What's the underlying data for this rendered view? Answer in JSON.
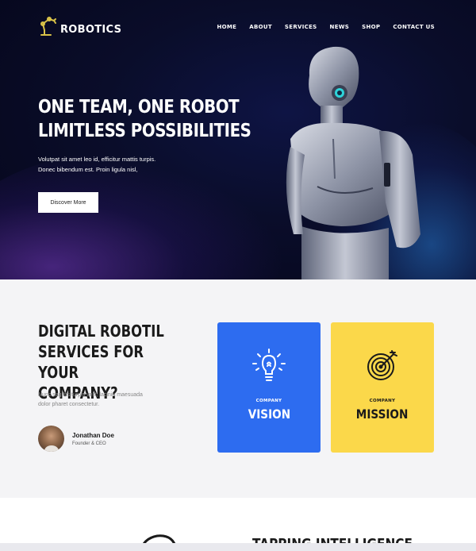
{
  "brand": {
    "name": "ROBOTICS",
    "icon": "robot-arm-icon",
    "accent": "#d9c248"
  },
  "nav": [
    "HOME",
    "ABOUT",
    "SERVICES",
    "NEWS",
    "SHOP",
    "CONTACT US"
  ],
  "hero": {
    "title_line1": "ONE TEAM, ONE ROBOT",
    "title_line2": "LIMITLESS POSSIBILITIES",
    "subtitle_line1": "Volutpat sit amet leo id, efficitur mattis turpis.",
    "subtitle_line2": "Donec bibendum est. Proin ligula nisl,",
    "cta": "Discover More"
  },
  "services": {
    "title_line1": "DIGITAL ROBOTIL",
    "title_line2": "SERVICES FOR YOUR",
    "title_line3": "COMPANY?",
    "desc_line1": "Nunc sagittis turpis velit, lacinia maesuada",
    "desc_line2": "dolor pharet consectetur.",
    "author_name": "Jonathan Doe",
    "author_role": "Founder & CEO",
    "cards": [
      {
        "small": "COMPANY",
        "big": "VISION",
        "icon": "lightbulb-icon",
        "color": "#2d6cf0"
      },
      {
        "small": "COMPANY",
        "big": "MISSION",
        "icon": "target-icon",
        "color": "#fbd84a"
      }
    ]
  },
  "next_section": {
    "title": "TAPPING INTELLIGENCE"
  }
}
